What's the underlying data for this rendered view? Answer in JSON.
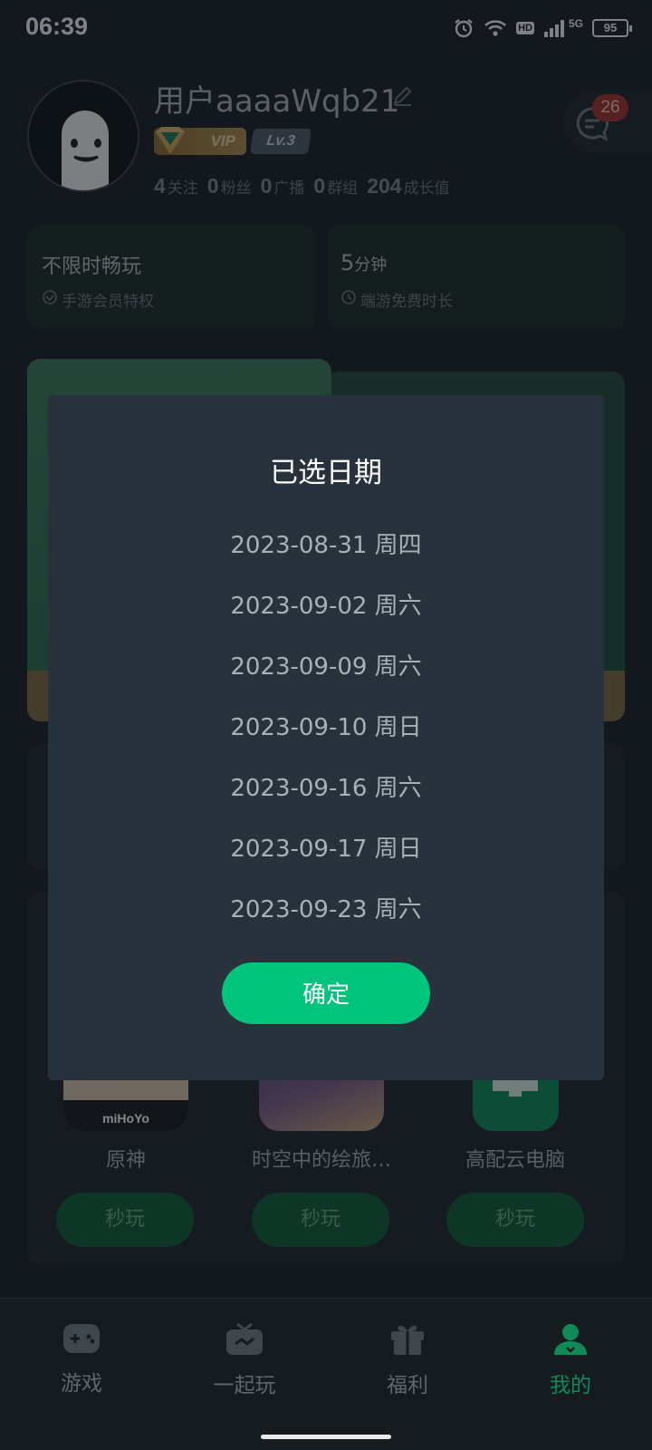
{
  "status_bar": {
    "time": "06:39",
    "battery": "95",
    "network": "5G",
    "hd_label": "HD"
  },
  "profile": {
    "username": "用户aaaaWqb21",
    "vip_label": "VIP",
    "level_label": "Lv.3",
    "stats": [
      {
        "value": "4",
        "label": "关注"
      },
      {
        "value": "0",
        "label": "粉丝"
      },
      {
        "value": "0",
        "label": "广播"
      },
      {
        "value": "0",
        "label": "群组"
      },
      {
        "value": "204",
        "label": "成长值"
      }
    ],
    "message_count": "26"
  },
  "cards": {
    "left_title": "不限时畅玩",
    "left_sub": "手游会员特权",
    "right_title_num": "5",
    "right_title_unit": "分钟",
    "right_sub": "端游免费时长"
  },
  "games": [
    {
      "name": "原神",
      "button": "秒玩",
      "logo_text": "miHoYo"
    },
    {
      "name": "时空中的绘旅…",
      "button": "秒玩"
    },
    {
      "name": "高配云电脑",
      "button": "秒玩"
    }
  ],
  "bottom_nav": [
    {
      "label": "游戏",
      "icon": "gamepad-icon",
      "active": false
    },
    {
      "label": "一起玩",
      "icon": "tv-icon",
      "active": false
    },
    {
      "label": "福利",
      "icon": "gift-icon",
      "active": false
    },
    {
      "label": "我的",
      "icon": "person-icon",
      "active": true
    }
  ],
  "dialog": {
    "title": "已选日期",
    "dates": [
      "2023-08-31 周四",
      "2023-09-02 周六",
      "2023-09-09 周六",
      "2023-09-10 周日",
      "2023-09-16 周六",
      "2023-09-17 周日",
      "2023-09-23 周六"
    ],
    "confirm_label": "确定"
  },
  "colors": {
    "accent": "#00c47c",
    "dialog_bg": "#28323c",
    "badge_red": "#a3312e",
    "nav_active": "#0f8a58"
  }
}
